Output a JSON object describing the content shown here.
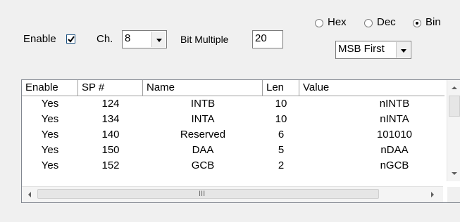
{
  "controls": {
    "enable_label": "Enable",
    "enable_checked": true,
    "ch_label": "Ch.",
    "ch_value": "8",
    "bit_multiple_label": "Bit Multiple",
    "bit_multiple_value": "20",
    "format_options": [
      "Hex",
      "Dec",
      "Bin"
    ],
    "format_selected": "Bin",
    "bit_order_value": "MSB First"
  },
  "table": {
    "columns": [
      "Enable",
      "SP #",
      "Name",
      "Len",
      "Value"
    ],
    "rows": [
      [
        "Yes",
        "124",
        "INTB",
        "10",
        "nINTB"
      ],
      [
        "Yes",
        "134",
        "INTA",
        "10",
        "nINTA"
      ],
      [
        "Yes",
        "140",
        "Reserved",
        "6",
        "101010"
      ],
      [
        "Yes",
        "150",
        "DAA",
        "5",
        "nDAA"
      ],
      [
        "Yes",
        "152",
        "GCB",
        "2",
        "nGCB"
      ]
    ],
    "hscroll_grip": "III"
  }
}
